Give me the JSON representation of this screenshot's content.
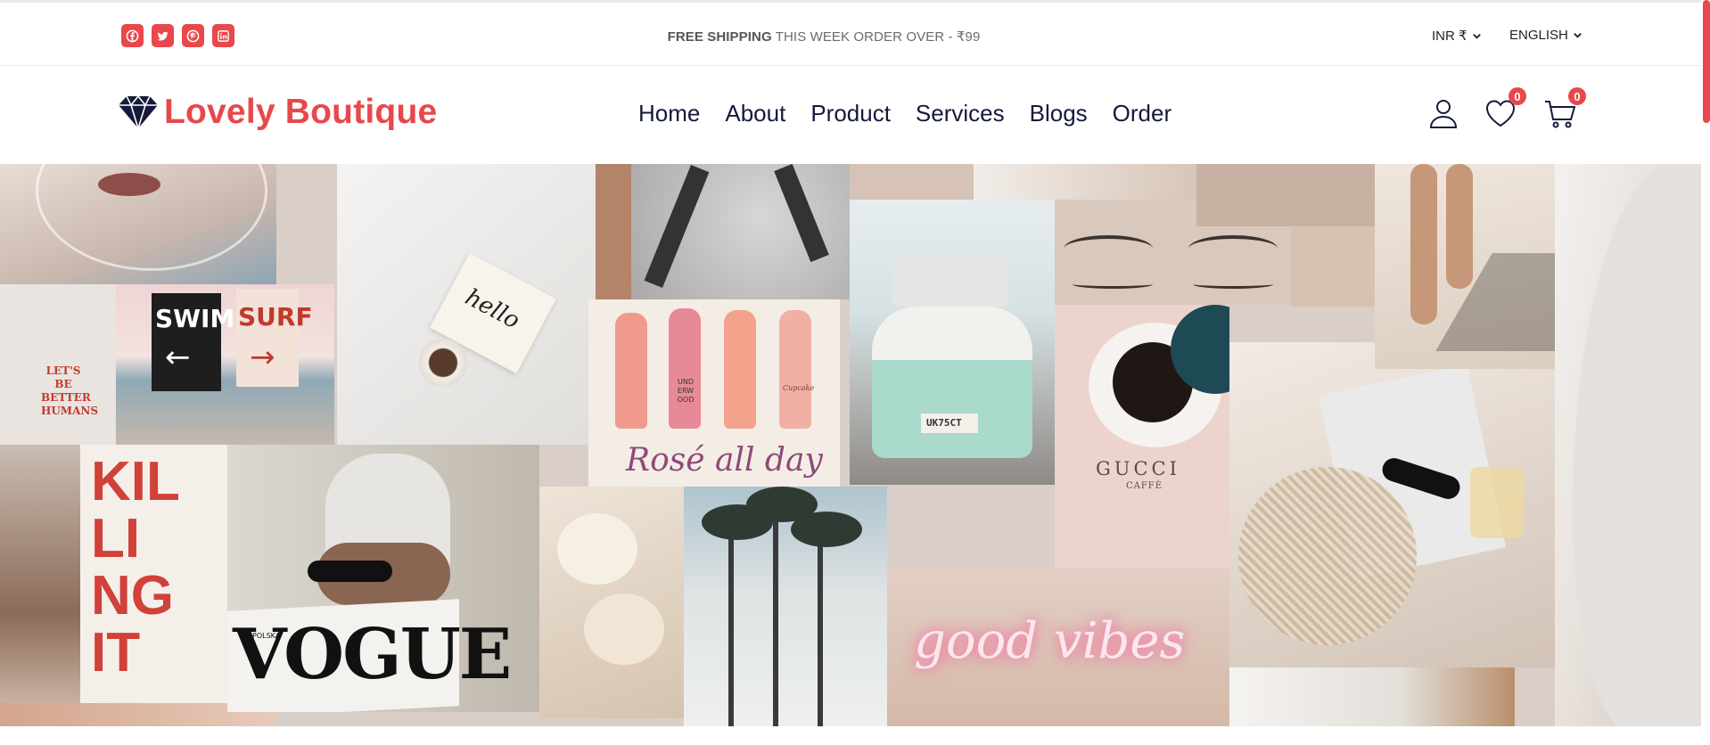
{
  "topbar": {
    "socials": [
      "facebook-icon",
      "twitter-icon",
      "pinterest-icon",
      "linkedin-icon"
    ],
    "promo_strong": "FREE SHIPPING",
    "promo_rest": " THIS WEEK ORDER OVER - ₹99",
    "currency": "INR ₹",
    "language": "ENGLISH"
  },
  "header": {
    "logo_icon": "diamond-icon",
    "brand": "Lovely Boutique",
    "nav": [
      "Home",
      "About",
      "Product",
      "Services",
      "Blogs",
      "Order"
    ],
    "user_icon": "user-icon",
    "wishlist_icon": "heart-icon",
    "wishlist_count": "0",
    "cart_icon": "cart-icon",
    "cart_count": "0"
  },
  "hero": {
    "image": "aesthetic-collage-banner",
    "tiles": {
      "swim": "SWIM",
      "surf": "SURF",
      "lets_be": "LET'S BE BETTER HUMANS",
      "hello": "hello",
      "killing": "KIL LI NG IT",
      "vogue": "VOGUE",
      "polska": "POLSKA",
      "rose": "Rosé all day",
      "und": "UND ERW OOD",
      "cupcake": "Cupcake",
      "plate": "UK75CT",
      "gucci": "GUCCI",
      "caffe": "CAFFÈ",
      "good_vibes": "good vibes"
    }
  },
  "colors": {
    "accent": "#e8484b",
    "nav_text": "#151a3c"
  }
}
